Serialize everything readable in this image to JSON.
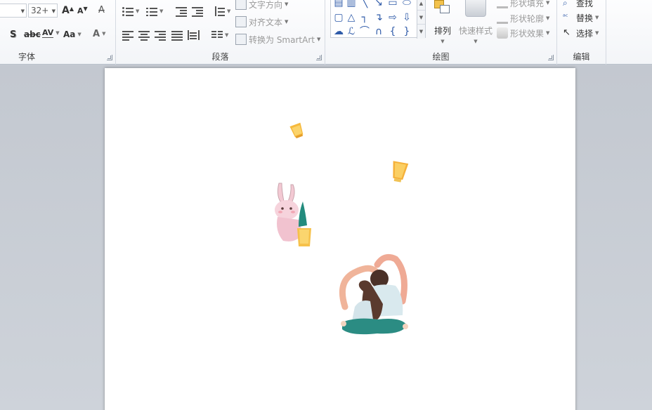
{
  "ribbon": {
    "font": {
      "label": "字体",
      "size_value": "32+",
      "grow_icon": "A",
      "shrink_icon": "A",
      "clear_icon": "A",
      "shadow_icon": "S",
      "strike_icon": "abc",
      "spacing_icon": "AV",
      "case_icon": "Aa",
      "color_icon": "A"
    },
    "paragraph": {
      "label": "段落",
      "text_direction": "文字方向",
      "align_text": "对齐文本",
      "convert_smartart": "转换为 SmartArt"
    },
    "drawing": {
      "label": "绘图",
      "arrange": "排列",
      "quick_styles": "快速样式",
      "shape_fill": "形状填充",
      "shape_outline": "形状轮廓",
      "shape_effects": "形状效果"
    },
    "editing": {
      "label": "编辑",
      "find": "查找",
      "replace": "替换",
      "select": "选择"
    }
  },
  "colors": {
    "accent": "#2e5aa8",
    "workspace": "#c6cbd3",
    "page": "#ffffff"
  }
}
